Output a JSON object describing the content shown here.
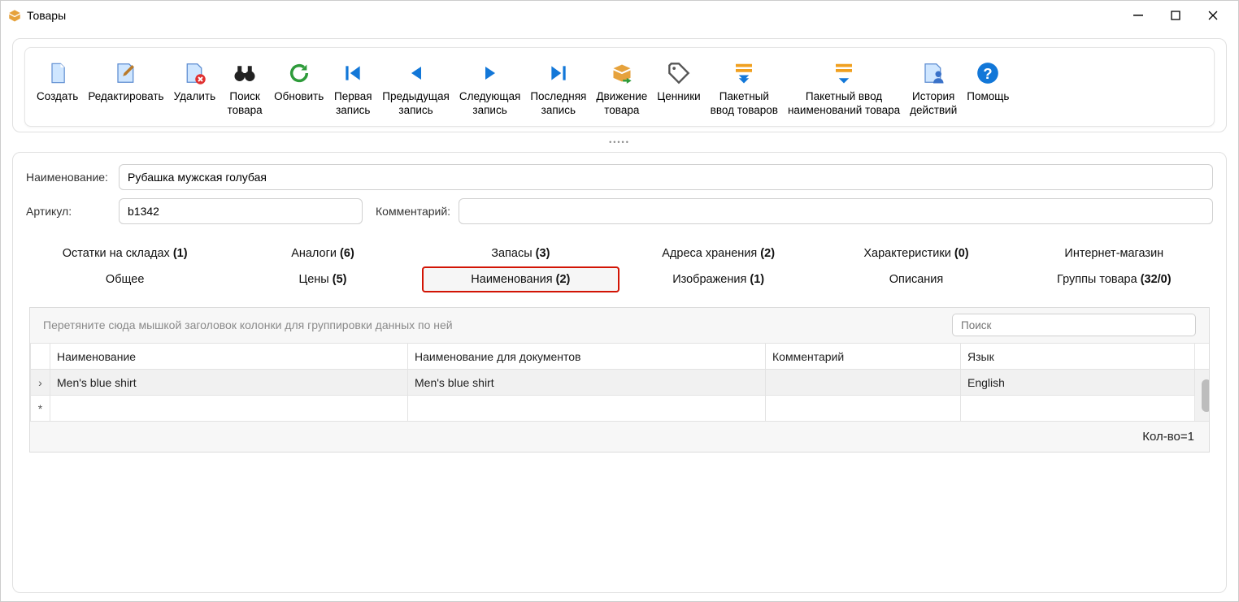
{
  "window": {
    "title": "Товары"
  },
  "toolbar": {
    "create": "Создать",
    "edit": "Редактировать",
    "delete": "Удалить",
    "search": "Поиск\nтовара",
    "refresh": "Обновить",
    "first": "Первая\nзапись",
    "prev": "Предыдущая\nзапись",
    "next": "Следующая\nзапись",
    "last": "Последняя\nзапись",
    "move": "Движение\nтовара",
    "pricetags": "Ценники",
    "batch_goods": "Пакетный\nввод товаров",
    "batch_names": "Пакетный ввод\nнаименований товара",
    "history": "История\nдействий",
    "help": "Помощь"
  },
  "form": {
    "name_label": "Наименование:",
    "name_value": "Рубашка мужская голубая",
    "sku_label": "Артикул:",
    "sku_value": "b1342",
    "comment_label": "Комментарий:",
    "comment_value": ""
  },
  "tabs_row1": [
    {
      "label": "Остатки на складах",
      "count": "(1)"
    },
    {
      "label": "Аналоги",
      "count": "(6)"
    },
    {
      "label": "Запасы",
      "count": "(3)"
    },
    {
      "label": "Адреса хранения",
      "count": "(2)"
    },
    {
      "label": "Характеристики",
      "count": "(0)"
    },
    {
      "label": "Интернет-магазин",
      "count": ""
    }
  ],
  "tabs_row2": [
    {
      "label": "Общее",
      "count": ""
    },
    {
      "label": "Цены",
      "count": "(5)"
    },
    {
      "label": "Наименования",
      "count": "(2)",
      "active": true
    },
    {
      "label": "Изображения",
      "count": "(1)"
    },
    {
      "label": "Описания",
      "count": ""
    },
    {
      "label": "Группы товара",
      "count": "(32/0)"
    }
  ],
  "grid": {
    "group_hint": "Перетяните сюда мышкой заголовок колонки для группировки данных по ней",
    "search_placeholder": "Поиск",
    "columns": [
      "Наименование",
      "Наименование для документов",
      "Комментарий",
      "Язык"
    ],
    "rows": [
      {
        "name": "Men's blue shirt",
        "doc_name": "Men's blue shirt",
        "comment": "",
        "lang": "English"
      }
    ],
    "footer": "Кол-во=1"
  }
}
